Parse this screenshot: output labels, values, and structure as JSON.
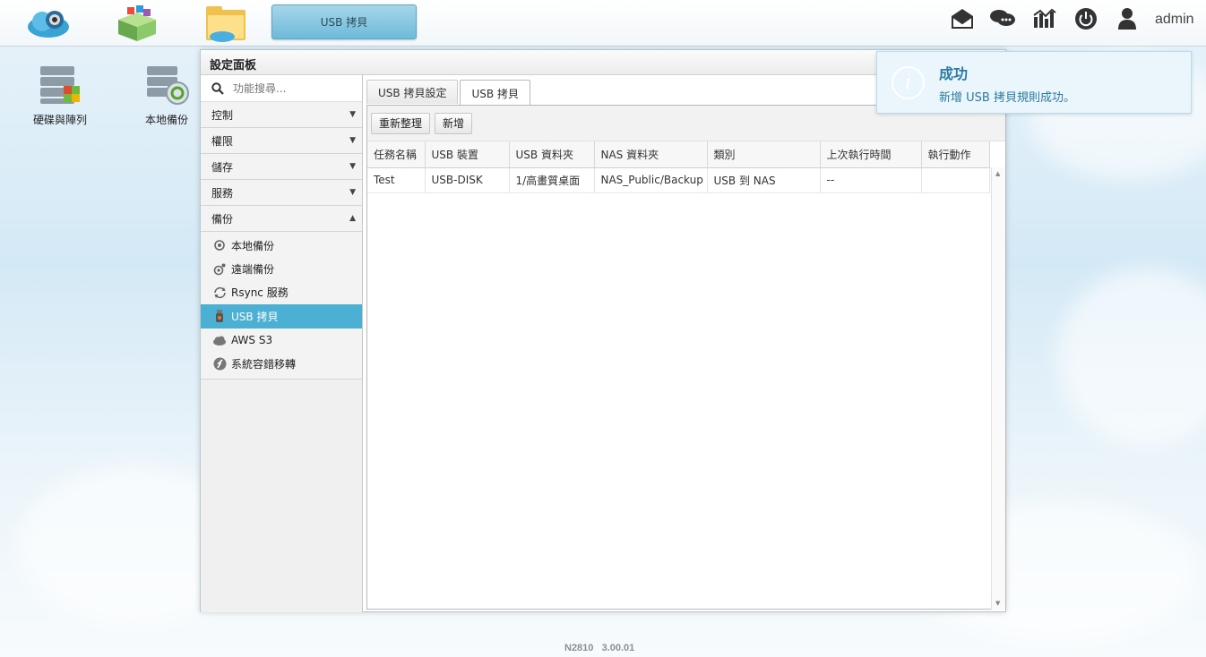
{
  "taskbar": {
    "apps": [
      "cloud-app-icon",
      "app-center-icon",
      "file-manager-icon"
    ],
    "active_task": "USB 拷貝",
    "user": "admin"
  },
  "desktop": {
    "icons": [
      {
        "label": "硬碟與陣列",
        "icon": "disk-array-icon"
      },
      {
        "label": "本地備份",
        "icon": "local-backup-icon"
      }
    ]
  },
  "panel": {
    "title": "設定面板",
    "search_placeholder": "功能搜尋...",
    "categories": [
      {
        "label": "控制",
        "expanded": false
      },
      {
        "label": "權限",
        "expanded": false
      },
      {
        "label": "儲存",
        "expanded": false
      },
      {
        "label": "服務",
        "expanded": false
      },
      {
        "label": "備份",
        "expanded": true
      }
    ],
    "backup_items": [
      {
        "label": "本地備份",
        "icon": "local-backup-icon"
      },
      {
        "label": "遠端備份",
        "icon": "remote-backup-icon"
      },
      {
        "label": "Rsync 服務",
        "icon": "rsync-icon"
      },
      {
        "label": "USB 拷貝",
        "icon": "usb-icon",
        "active": true
      },
      {
        "label": "AWS S3",
        "icon": "cloud-icon"
      },
      {
        "label": "系統容錯移轉",
        "icon": "failover-icon"
      }
    ],
    "tabs": [
      "USB 拷貝設定",
      "USB 拷貝"
    ],
    "active_tab": 1,
    "toolbar": {
      "refresh": "重新整理",
      "add": "新增"
    },
    "table": {
      "columns": [
        "任務名稱",
        "USB 裝置",
        "USB 資料夾",
        "NAS 資料夾",
        "類別",
        "上次執行時間",
        "執行動作"
      ],
      "rows": [
        [
          "Test",
          "USB-DISK",
          "1/高畫質桌面",
          "NAS_Public/Backup",
          "USB 到 NAS",
          "--",
          ""
        ]
      ]
    }
  },
  "toast": {
    "title": "成功",
    "message": "新增 USB 拷貝規則成功。"
  },
  "footer": {
    "model": "N2810",
    "version": "3.00.01"
  },
  "colors": {
    "accent": "#4cb0d4",
    "toast_text": "#2b7aa5"
  }
}
